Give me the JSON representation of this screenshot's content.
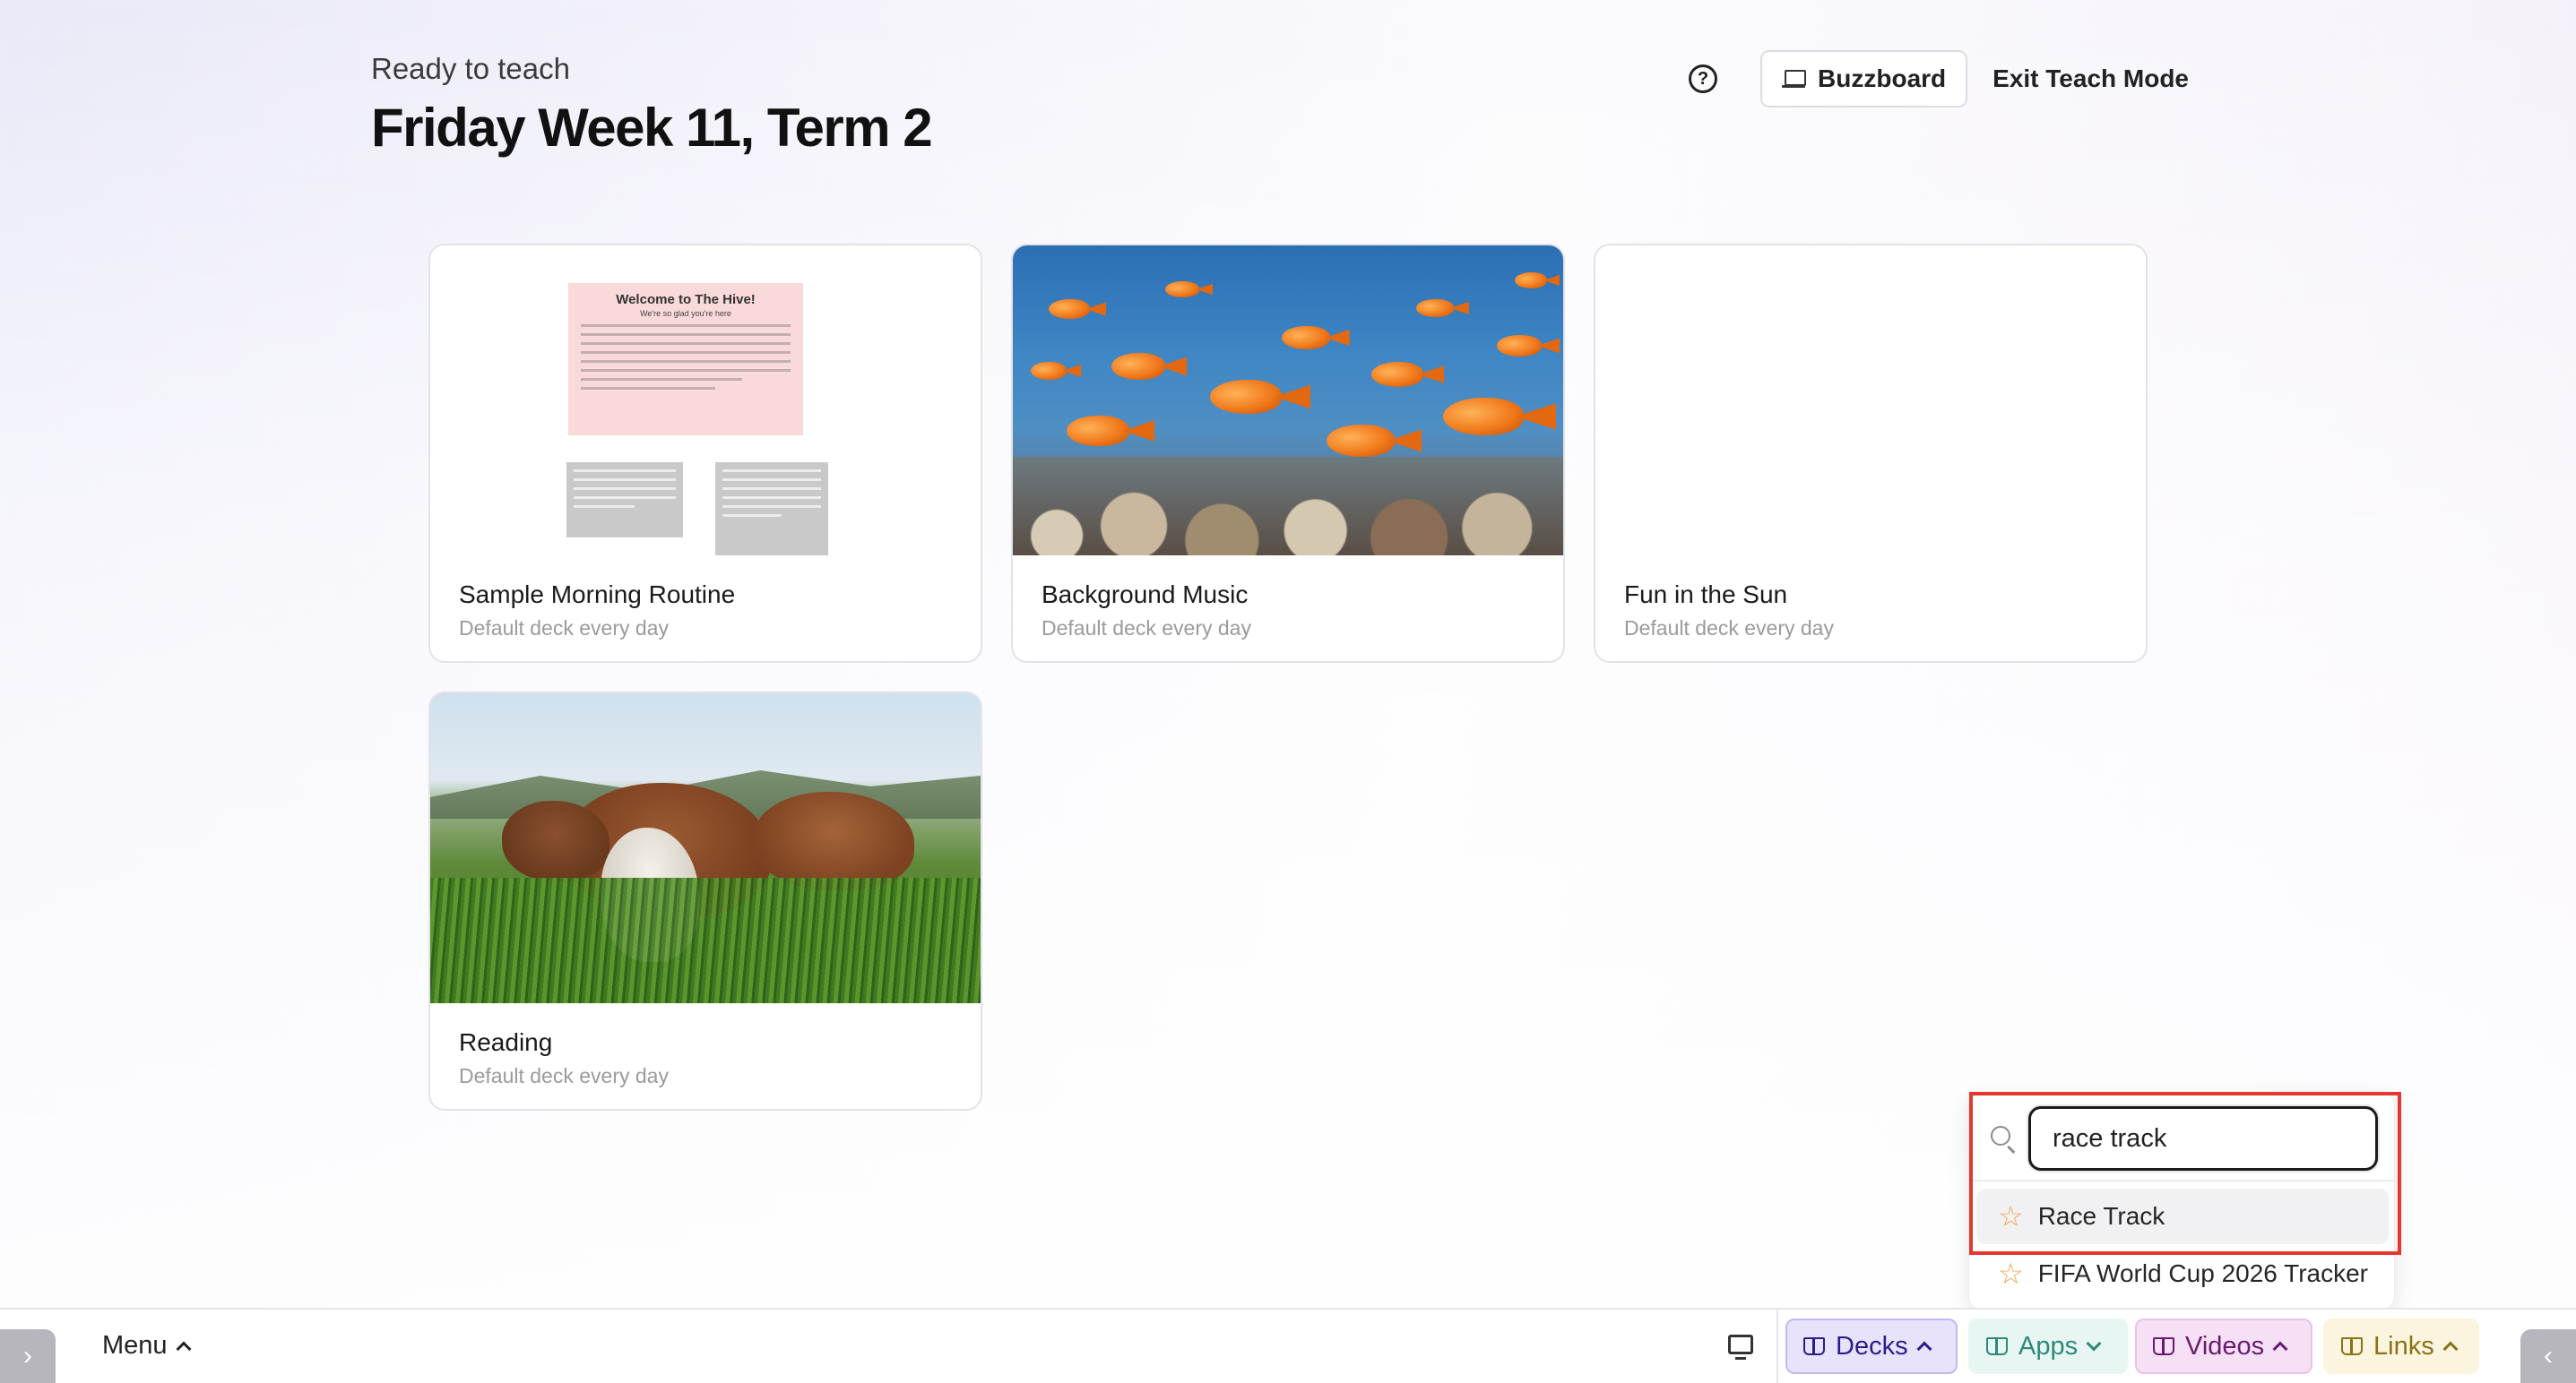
{
  "header": {
    "subtitle": "Ready to teach",
    "title": "Friday Week 11, Term 2"
  },
  "top_actions": {
    "help_icon": "question-circle-icon",
    "buzzboard_label": "Buzzboard",
    "exit_label": "Exit Teach Mode"
  },
  "decks": [
    {
      "name": "Sample Morning Routine",
      "subtitle": "Default deck every day",
      "thumb": "slide-preview"
    },
    {
      "name": "Background Music",
      "subtitle": "Default deck every day",
      "thumb": "fish-reef-photo"
    },
    {
      "name": "Fun in the Sun",
      "subtitle": "Default deck every day",
      "thumb": "blank"
    },
    {
      "name": "Reading",
      "subtitle": "Default deck every day",
      "thumb": "cows-meadow-photo"
    }
  ],
  "slide_preview": {
    "title": "Welcome to The Hive!",
    "subtitle": "We're so glad you're here"
  },
  "search": {
    "value": "race track",
    "results": [
      {
        "label": "Race Track",
        "icon": "star-outline-icon",
        "active": true
      },
      {
        "label": "FIFA World Cup 2026 Tracker",
        "icon": "star-outline-icon",
        "active": false
      }
    ]
  },
  "bottom_bar": {
    "menu_label": "Menu",
    "decks_label": "Decks",
    "apps_label": "Apps",
    "videos_label": "Videos",
    "links_label": "Links"
  },
  "colors": {
    "decks_accent": "#2c1e86",
    "apps_accent": "#2d8a78",
    "videos_accent": "#6a1a70",
    "links_accent": "#8b7213",
    "highlight": "#e5372f",
    "star": "#f2a64a"
  }
}
